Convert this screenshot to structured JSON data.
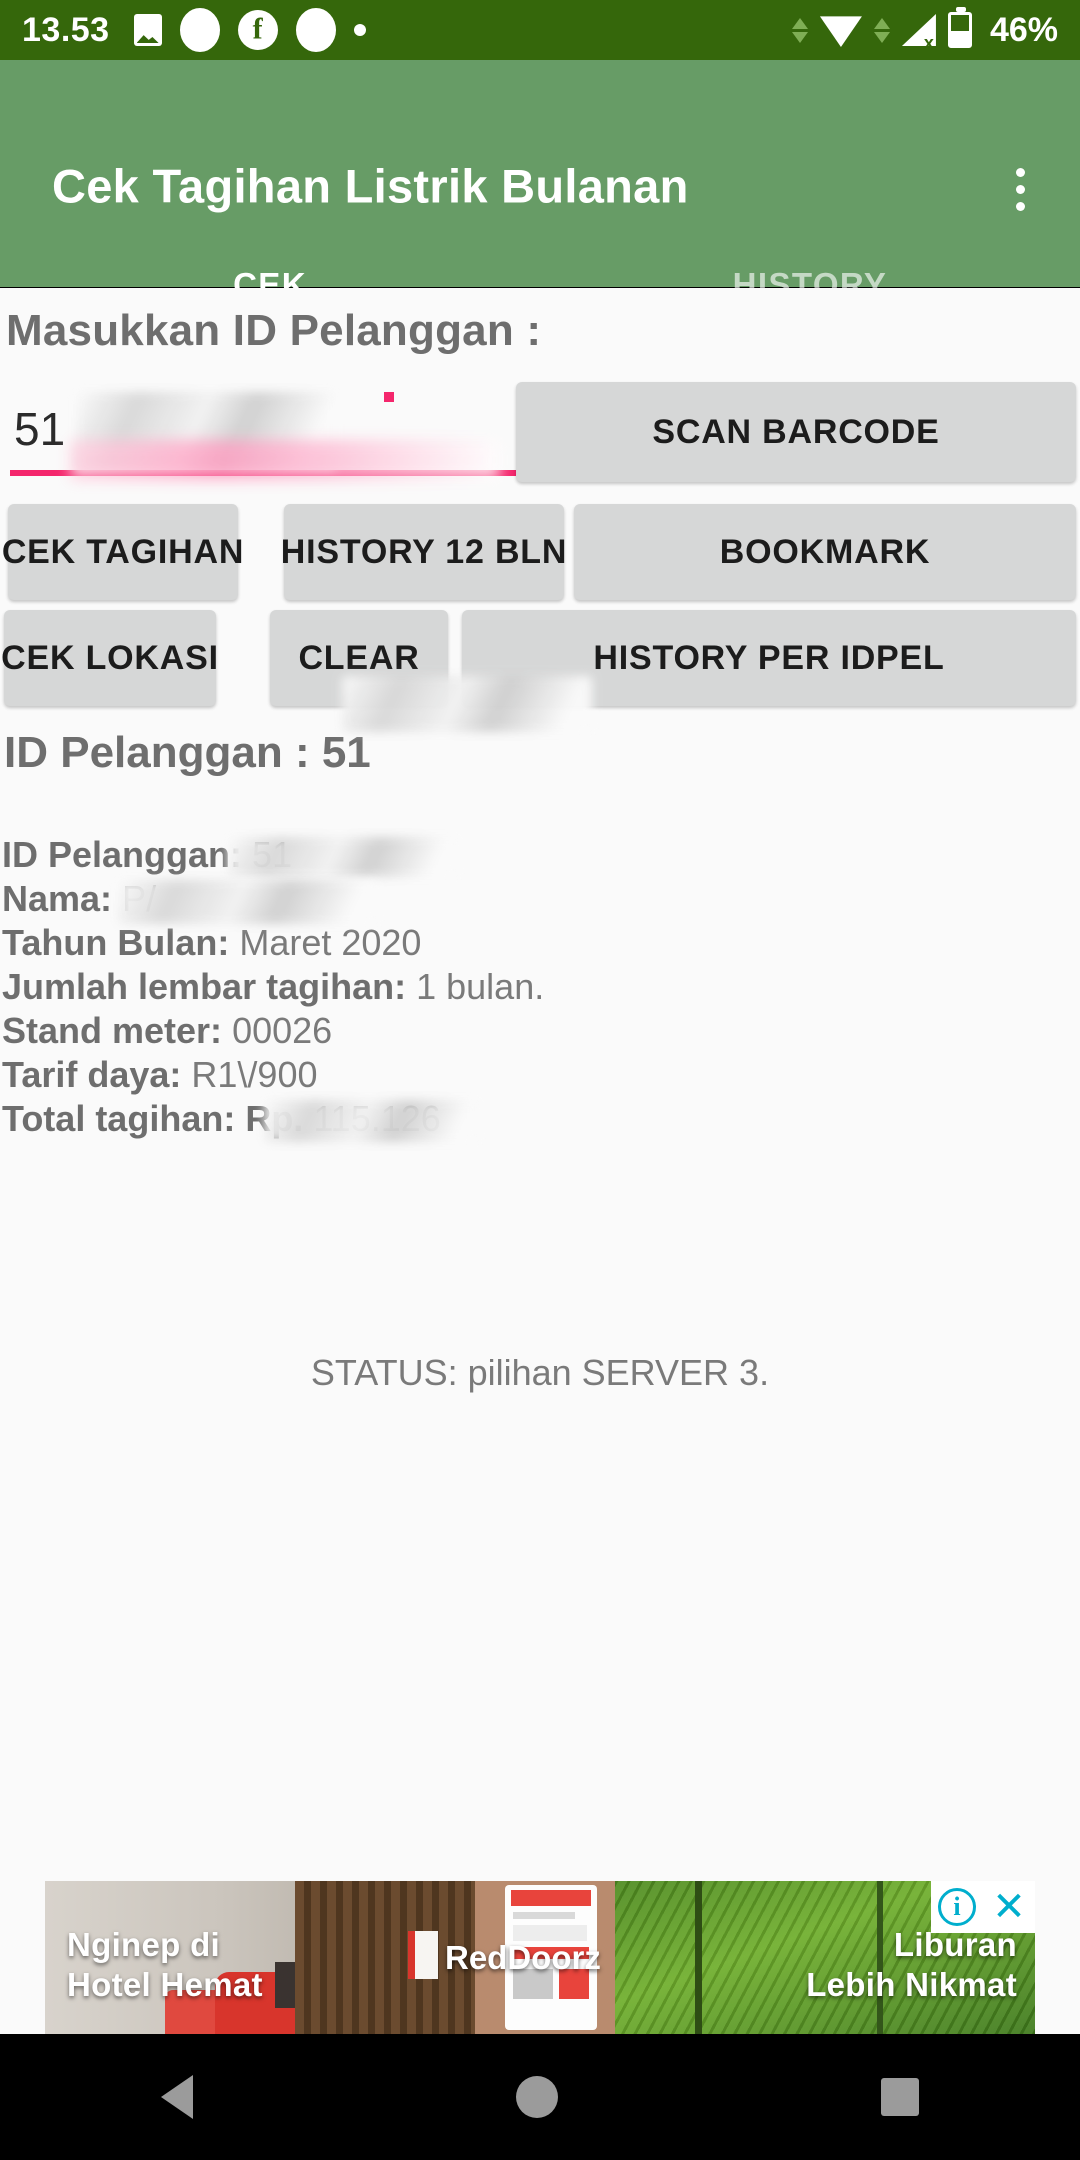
{
  "status_bar": {
    "time": "13.53",
    "battery_percent": "46%",
    "icons": [
      "image-icon",
      "oval-icon",
      "facebook-icon",
      "oval-icon",
      "dot-icon",
      "data-transfer-icon",
      "wifi-icon",
      "signal-off-icon",
      "battery-icon"
    ]
  },
  "appbar": {
    "title": "Cek Tagihan Listrik Bulanan",
    "overflow_label": "more-options",
    "color": "#679c66",
    "status_color": "#35670b"
  },
  "tabs": {
    "items": [
      {
        "label": "CEK",
        "active": true
      },
      {
        "label": "HISTORY",
        "active": false
      }
    ],
    "indicator_color": "#f4266c"
  },
  "form": {
    "section_title": "Masukkan ID Pelanggan :",
    "idpel_value": "51",
    "idpel_placeholder": "",
    "scan_button": "SCAN BARCODE"
  },
  "actions": {
    "row1": [
      "CEK TAGIHAN",
      "HISTORY 12 BLN",
      "BOOKMARK"
    ],
    "row2": [
      "CEK LOKASI",
      "CLEAR",
      "HISTORY PER IDPEL"
    ]
  },
  "result": {
    "heading_label": "ID Pelanggan :",
    "heading_value": "51",
    "details": [
      {
        "label": "ID Pelanggan:",
        "value": "51"
      },
      {
        "label": "Nama:",
        "value": "P/"
      },
      {
        "label": "Tahun Bulan:",
        "value": "Maret 2020"
      },
      {
        "label": "Jumlah lembar tagihan:",
        "value": "1 bulan."
      },
      {
        "label": "Stand meter:",
        "value": "00026"
      },
      {
        "label": "Tarif daya:",
        "value": "R1\\/900"
      },
      {
        "label": "Total tagihan: Rp.",
        "value": "115.126"
      }
    ]
  },
  "status_message": "STATUS: pilihan SERVER 3.",
  "ad": {
    "headline_left": "Nginep di\nHotel Hemat",
    "headline_right": "Liburan\nLebih Nikmat",
    "brand": "RedDoorz",
    "info_label": "i",
    "close_label": "✕"
  },
  "navbar": {
    "back": "back-button",
    "home": "home-button",
    "recent": "recent-apps-button"
  }
}
